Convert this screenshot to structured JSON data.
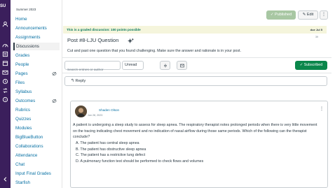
{
  "global_nav": {
    "logo": "SU",
    "icons": [
      "account-icon",
      "dashboard-icon",
      "courses-icon",
      "calendar-icon",
      "inbox-icon",
      "history-icon",
      "commons-icon",
      "help-icon",
      "collapse-icon"
    ]
  },
  "course_nav": {
    "term": "Summer 2023",
    "items": [
      {
        "label": "Home"
      },
      {
        "label": "Announcements"
      },
      {
        "label": "Assignments"
      },
      {
        "label": "Discussions"
      },
      {
        "label": "Grades"
      },
      {
        "label": "People"
      },
      {
        "label": "Pages"
      },
      {
        "label": "Files"
      },
      {
        "label": "Syllabus"
      },
      {
        "label": "Outcomes"
      },
      {
        "label": "Rubrics"
      },
      {
        "label": "Quizzes"
      },
      {
        "label": "Modules"
      },
      {
        "label": "BigBlueButton"
      },
      {
        "label": "Collaborations"
      },
      {
        "label": "Attendance"
      },
      {
        "label": "Chat"
      },
      {
        "label": "Input Final Grades"
      },
      {
        "label": "Starfish"
      }
    ]
  },
  "toolbar": {
    "published_label": "Published",
    "edit_label": "Edit",
    "kebab": "⋮"
  },
  "graded": {
    "text": "This is a graded discussion: 100 points possible",
    "due": "due Jul 5"
  },
  "topic": {
    "title": "Post #8-LJU Question",
    "count": "39",
    "prompt": "Cut and past one question that you found challenging. Make sure the answer and rationale is in your post."
  },
  "controls": {
    "search_placeholder": "Search entries or author",
    "unread_label": "Unread",
    "subscribed_label": "Subscribed"
  },
  "reply": {
    "label": "Reply"
  },
  "entry": {
    "author": "Shaden Olson",
    "date": "Jun 28, 2023",
    "kebab": "⋮",
    "paragraph": "A patient is undergoing a sleep study to assess for sleep apnea. The respiratory therapist notes prolonged periods when there is very little movement on the tracing indicating chest movement and no indication of nasal airflow during those same periods. Which of the following can the therapist conclude?",
    "answers": [
      "A.  The patient has central sleep apnea",
      "B.  The patient has obstructive sleep apnea",
      "C.  The patient has a restrictive lung defect",
      "D.  A pulmonary function test should be performed to check flows and volumes"
    ]
  },
  "colors": {
    "global_nav": "#3b1f5c",
    "link": "#0770a3",
    "published": "#a8c7a3",
    "subscribed": "#0b874b",
    "graded_text": "#0b7a5f"
  }
}
